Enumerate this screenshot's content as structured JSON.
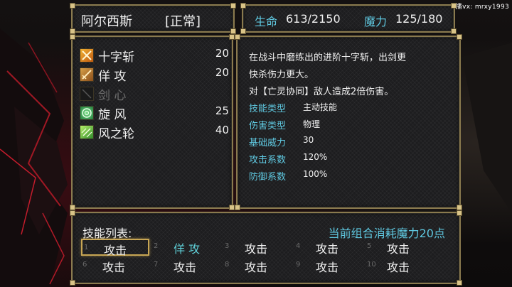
{
  "watermark": "主播vx: mrxy1993",
  "character": {
    "name": "阿尔西斯",
    "state": "[正常]"
  },
  "stats": {
    "hp_label": "生命",
    "hp_value": "613/2150",
    "mp_label": "魔力",
    "mp_value": "125/180"
  },
  "skills": [
    {
      "name": "十字斩",
      "power": "20",
      "icon": "cross-slash-icon",
      "enabled": true
    },
    {
      "name": "佯 攻",
      "power": "20",
      "icon": "feint-icon",
      "enabled": true
    },
    {
      "name": "剑 心",
      "power": "",
      "icon": "sword-heart-icon",
      "enabled": false
    },
    {
      "name": "旋 风",
      "power": "25",
      "icon": "whirlwind-icon",
      "enabled": true
    },
    {
      "name": "风之轮",
      "power": "40",
      "icon": "wind-wheel-icon",
      "enabled": true
    }
  ],
  "description": {
    "lines": [
      "在战斗中磨练出的进阶十字斩，出剑更",
      "快杀伤力更大。",
      "对【亡灵协同】敌人造成2倍伤害。"
    ],
    "attributes": [
      {
        "label": "技能类型",
        "value": "主动技能"
      },
      {
        "label": "伤害类型",
        "value": "物理"
      },
      {
        "label": "基础威力",
        "value": "30"
      },
      {
        "label": "攻击系数",
        "value": "120%"
      },
      {
        "label": "防御系数",
        "value": "100%"
      }
    ]
  },
  "combo": {
    "title": "技能列表:",
    "cost_text": "当前组合消耗魔力20点",
    "slots": [
      {
        "num": "1",
        "name": "攻击"
      },
      {
        "num": "2",
        "name": "佯 攻"
      },
      {
        "num": "3",
        "name": "攻击"
      },
      {
        "num": "4",
        "name": "攻击"
      },
      {
        "num": "5",
        "name": "攻击"
      },
      {
        "num": "6",
        "name": "攻击"
      },
      {
        "num": "7",
        "name": "攻击"
      },
      {
        "num": "8",
        "name": "攻击"
      },
      {
        "num": "9",
        "name": "攻击"
      },
      {
        "num": "10",
        "name": "攻击"
      }
    ]
  },
  "colors": {
    "accent": "#5fc8e0",
    "frame": "#8a7a4e",
    "highlight": "#c8a654"
  }
}
